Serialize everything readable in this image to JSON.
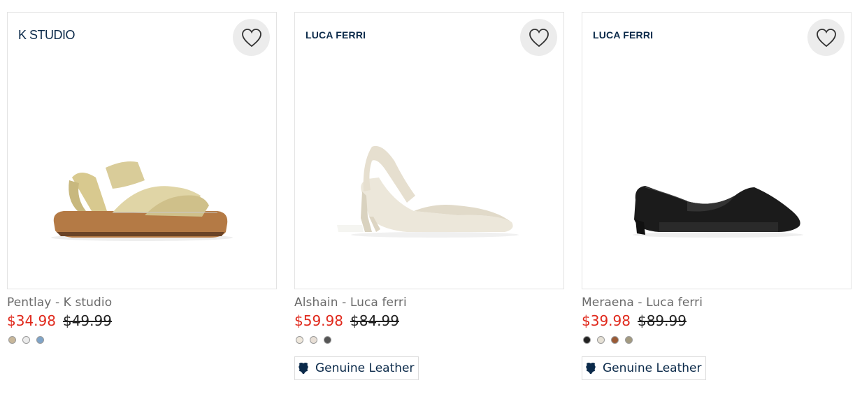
{
  "products": [
    {
      "brand": "K STUDIO",
      "name": "Pentlay - K studio",
      "sale_price": "$34.98",
      "original_price": "$49.99",
      "swatch_colors": [
        "#c8b79a",
        "#ececec",
        "#7fa4c8"
      ],
      "badge": null
    },
    {
      "brand": "LUCA FERRI",
      "name": "Alshain - Luca ferri",
      "sale_price": "$59.98",
      "original_price": "$84.99",
      "swatch_colors": [
        "#efe8dc",
        "#e8dfd6",
        "#555555"
      ],
      "badge": "Genuine Leather"
    },
    {
      "brand": "LUCA FERRI",
      "name": "Meraena - Luca ferri",
      "sale_price": "$39.98",
      "original_price": "$89.99",
      "swatch_colors": [
        "#222222",
        "#e6e1d6",
        "#9a5a35",
        "#a39a80"
      ],
      "badge": "Genuine Leather"
    }
  ],
  "icons": {
    "wishlist": "heart-outline-icon",
    "badge": "leather-hide-icon"
  },
  "colors": {
    "sale": "#e0281b",
    "brand": "#0b2a4a"
  }
}
